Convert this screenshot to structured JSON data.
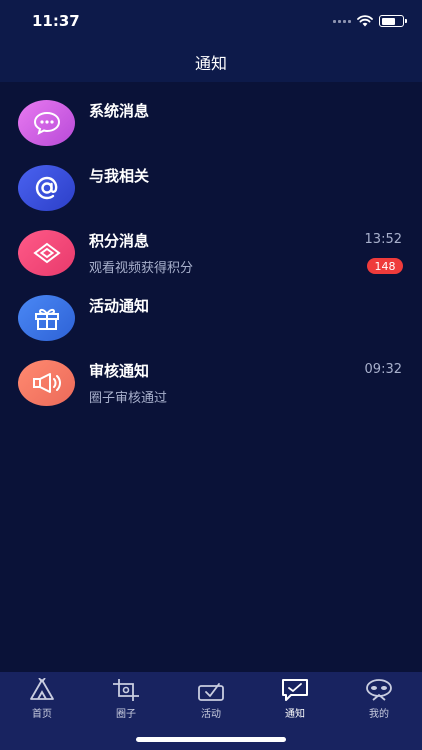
{
  "status_bar": {
    "time": "11:37"
  },
  "header": {
    "title": "通知"
  },
  "items": [
    {
      "title": "系统消息",
      "subtitle": "",
      "time": "",
      "badge": "",
      "icon": "chat-bubble-icon",
      "color": "#d85ee8"
    },
    {
      "title": "与我相关",
      "subtitle": "",
      "time": "",
      "badge": "",
      "icon": "at-sign-icon",
      "color": "#3b4fd8"
    },
    {
      "title": "积分消息",
      "subtitle": "观看视频获得积分",
      "time": "13:52",
      "badge": "148",
      "icon": "diamond-icon",
      "color": "#f0457a"
    },
    {
      "title": "活动通知",
      "subtitle": "",
      "time": "",
      "badge": "",
      "icon": "gift-icon",
      "color": "#3a76e8"
    },
    {
      "title": "审核通知",
      "subtitle": "圈子审核通过",
      "time": "09:32",
      "badge": "",
      "icon": "megaphone-icon",
      "color": "#f07a66"
    }
  ],
  "tabs": [
    {
      "label": "首页",
      "icon": "tent-icon"
    },
    {
      "label": "圈子",
      "icon": "crop-icon"
    },
    {
      "label": "活动",
      "icon": "ticket-icon"
    },
    {
      "label": "通知",
      "icon": "message-icon",
      "active": true
    },
    {
      "label": "我的",
      "icon": "mask-icon"
    }
  ]
}
